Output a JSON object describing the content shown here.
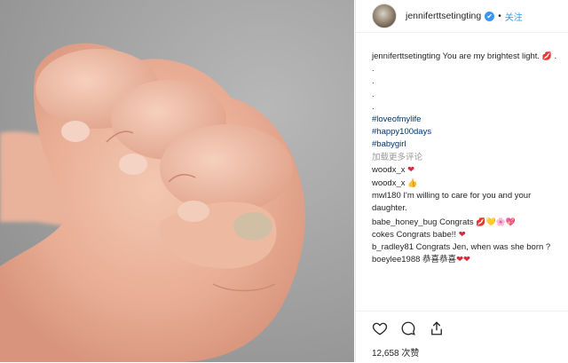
{
  "header": {
    "username": "jenniferttsetingting",
    "verified_glyph": "✔",
    "separator": "•",
    "follow_label": "关注"
  },
  "caption": {
    "username": "jenniferttsetingting",
    "text": " You are my brightest light. ",
    "dots": [
      ".",
      ".",
      ".",
      "."
    ],
    "hashtags": [
      "#loveofmylife",
      "#happy100days",
      "#babygirl"
    ]
  },
  "load_more": "加载更多评论",
  "comments": [
    {
      "user": "woodx_x",
      "text": " ",
      "emoji": "❤"
    },
    {
      "user": "woodx_x",
      "text": " ",
      "emoji": "👍"
    },
    {
      "user": "mwl180",
      "text": " I'm willing to care for you and your daughter.",
      "emoji": ""
    },
    {
      "user": "babe_honey_bug",
      "text": " Congrats ",
      "emoji": "💋💛🌸💖"
    },
    {
      "user": "cokes",
      "text": " Congrats babe!! ",
      "emoji": "❤"
    },
    {
      "user": "b_radley81",
      "text": " Congrats Jen, when was she born ?",
      "emoji": ""
    },
    {
      "user": "boeylee1988",
      "text": " 恭喜恭喜",
      "emoji": "❤❤"
    }
  ],
  "likes": "12,658 次赞",
  "icons": [
    "heart-icon",
    "comment-icon",
    "share-icon"
  ],
  "colors": {
    "link_blue": "#3897f0",
    "hashtag": "#003569",
    "heart": "#d8283c"
  }
}
